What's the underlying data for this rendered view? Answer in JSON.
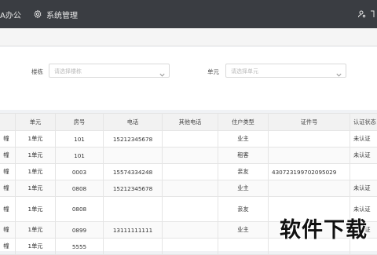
{
  "topbar": {
    "app_fragment": "A办公",
    "settings_label": "系统管理"
  },
  "filters": {
    "building_label": "楼栋",
    "building_placeholder": "请选择楼栋",
    "unit_label": "单元",
    "unit_placeholder": "请选择单元"
  },
  "table": {
    "headers": [
      "",
      "单元",
      "房号",
      "电话",
      "其他电话",
      "住户类型",
      "证件号",
      "认证状态"
    ],
    "rows": [
      [
        "幢",
        "1单元",
        "101",
        "15212345678",
        "",
        "业主",
        "",
        "未认证"
      ],
      [
        "幢",
        "1单元",
        "101",
        "",
        "",
        "租客",
        "",
        "未认证"
      ],
      [
        "幢",
        "1单元",
        "0003",
        "15574334248",
        "",
        "亲友",
        "430723199702095029",
        ""
      ],
      [
        "幢",
        "1单元",
        "0808",
        "15212345678",
        "",
        "业主",
        "",
        "未认证"
      ],
      [
        "幢",
        "1单元",
        "0808",
        "",
        "",
        "亲友",
        "",
        "未认证"
      ],
      [
        "幢",
        "1单元",
        "0899",
        "13111111111",
        "",
        "业主",
        "",
        "未认证"
      ],
      [
        "幢",
        "1单元",
        "5555",
        "",
        "",
        "",
        "",
        ""
      ]
    ]
  },
  "watermark": "软件下载"
}
